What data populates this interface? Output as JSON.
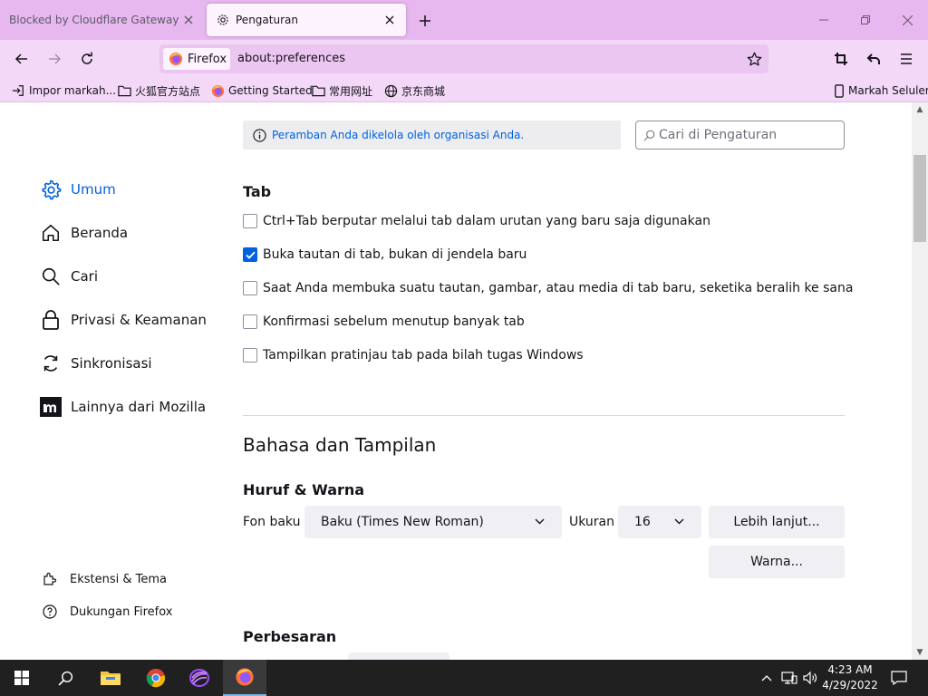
{
  "tabs": [
    {
      "title": "Blocked by Cloudflare Gateway",
      "active": false
    },
    {
      "title": "Pengaturan",
      "active": true
    }
  ],
  "urlbar": {
    "identity": "Firefox",
    "url": "about:preferences"
  },
  "bookmarks": [
    {
      "label": "Impor markah...",
      "icon": "import-icon"
    },
    {
      "label": "火狐官方站点",
      "icon": "folder-icon"
    },
    {
      "label": "Getting Started",
      "icon": "firefox-icon"
    },
    {
      "label": "常用网址",
      "icon": "folder-icon"
    },
    {
      "label": "京东商城",
      "icon": "globe-icon"
    }
  ],
  "mobile_bookmarks": "Markah Seluler",
  "policy_notice": "Peramban Anda dikelola oleh organisasi Anda.",
  "search": {
    "placeholder": "Cari di Pengaturan"
  },
  "sidebar": {
    "items": [
      {
        "label": "Umum",
        "icon": "gear-icon",
        "active": true
      },
      {
        "label": "Beranda",
        "icon": "home-icon",
        "active": false
      },
      {
        "label": "Cari",
        "icon": "search-icon",
        "active": false
      },
      {
        "label": "Privasi & Keamanan",
        "icon": "lock-icon",
        "active": false
      },
      {
        "label": "Sinkronisasi",
        "icon": "sync-icon",
        "active": false
      },
      {
        "label": "Lainnya dari Mozilla",
        "icon": "mozilla-icon",
        "active": false
      }
    ],
    "footer": [
      {
        "label": "Ekstensi & Tema",
        "icon": "puzzle-icon"
      },
      {
        "label": "Dukungan Firefox",
        "icon": "help-icon"
      }
    ]
  },
  "tabs_section": {
    "heading": "Tab",
    "options": [
      {
        "label": "Ctrl+Tab berputar melalui tab dalam urutan yang baru saja digunakan",
        "checked": false
      },
      {
        "label": "Buka tautan di tab, bukan di jendela baru",
        "checked": true
      },
      {
        "label": "Saat Anda membuka suatu tautan, gambar, atau media di tab baru, seketika beralih ke sana",
        "checked": false
      },
      {
        "label": "Konfirmasi sebelum menutup banyak tab",
        "checked": false
      },
      {
        "label": "Tampilkan pratinjau tab pada bilah tugas Windows",
        "checked": false
      }
    ]
  },
  "language_section": {
    "heading": "Bahasa dan Tampilan",
    "fonts_heading": "Huruf & Warna",
    "default_font_label": "Fon baku",
    "default_font_value": "Baku (Times New Roman)",
    "size_label": "Ukuran",
    "size_value": "16",
    "advanced_button": "Lebih lanjut...",
    "colors_button": "Warna..."
  },
  "zoom_section": {
    "heading": "Perbesaran"
  },
  "taskbar": {
    "time": "4:23 AM",
    "date": "4/29/2022"
  },
  "colors": {
    "accent": "#0061e0",
    "tabstrip": "#e7b7ef",
    "toolbar": "#f3d8f7"
  }
}
